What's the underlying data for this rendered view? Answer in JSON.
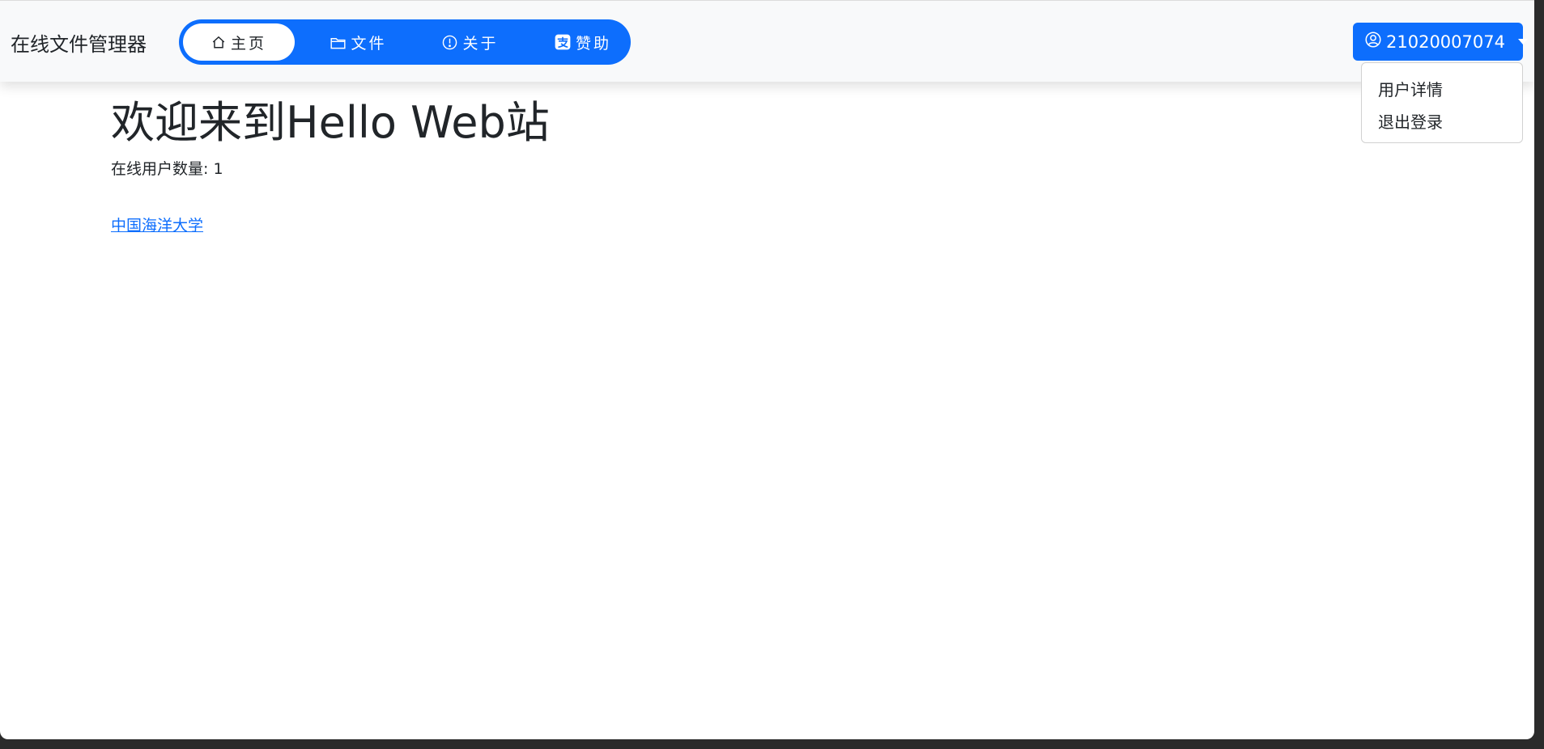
{
  "navbar": {
    "brand": "在线文件管理器",
    "items": [
      {
        "label": "主页",
        "icon": "home-icon",
        "active": true
      },
      {
        "label": "文件",
        "icon": "folder-icon",
        "active": false
      },
      {
        "label": "关于",
        "icon": "info-circle-icon",
        "active": false
      },
      {
        "label": "赞助",
        "icon": "alipay-icon",
        "active": false
      }
    ],
    "user": {
      "name": "21020007074",
      "icon": "user-circle-icon"
    }
  },
  "dropdown": {
    "items": [
      "用户详情",
      "退出登录"
    ]
  },
  "main": {
    "title": "欢迎来到Hello Web站",
    "online_users": "在线用户数量: 1",
    "link_text": "中国海洋大学"
  },
  "colors": {
    "primary": "#0d6efd",
    "navbar_bg": "#f8f9fa",
    "text": "#212529"
  }
}
